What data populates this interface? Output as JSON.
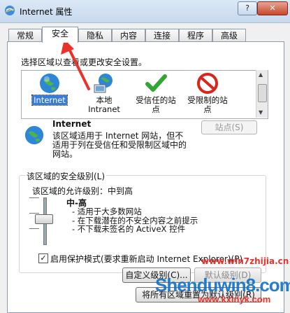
{
  "window": {
    "title": "Internet 属性",
    "help": "?",
    "close": "✕"
  },
  "tabs": [
    {
      "label": "常规"
    },
    {
      "label": "安全"
    },
    {
      "label": "隐私"
    },
    {
      "label": "内容"
    },
    {
      "label": "连接"
    },
    {
      "label": "程序"
    },
    {
      "label": "高级"
    }
  ],
  "zones": {
    "prompt": "选择区域以查看或更改安全设置。",
    "items": [
      {
        "label_1": "Internet",
        "label_2": "",
        "icon": "globe-icon"
      },
      {
        "label_1": "本地",
        "label_2": "Intranet",
        "icon": "intranet-icon"
      },
      {
        "label_1": "受信任的站",
        "label_2": "点",
        "icon": "checkmark-icon"
      },
      {
        "label_1": "受限制的站",
        "label_2": "点",
        "icon": "prohibited-icon"
      }
    ]
  },
  "zone_info": {
    "title": "Internet",
    "desc": "该区域适用于 Internet 网站，但不适用于列在受信任和受限制区域中的网站。",
    "sites_button": "站点(S)"
  },
  "security_level": {
    "group_label": "该区域的安全级别(L)",
    "allowed": "该区域的允许级别：中到高",
    "level_name": "中-高",
    "bullets": [
      "- 适用于大多数网站",
      "- 在下载潜在的不安全内容之前提示",
      "- 不下载未签名的 ActiveX 控件"
    ],
    "slider_level": "中-高"
  },
  "protected_mode": {
    "label": "启用保护模式(要求重新启动 Internet Explorer)(P)",
    "checked": true
  },
  "buttons": {
    "custom": "自定义级别(C)...",
    "default": "默认级别(D)",
    "reset": "将所有区域重置为默认级别(R)"
  },
  "watermark": {
    "line1": "www.win7zhijia.cn",
    "line2": "Shenduwin8.com",
    "line3": "www.kxinyk.com"
  },
  "colors": {
    "accent": "#3a7bd5",
    "arrow": "#e8322a",
    "warning": "#e8322a",
    "checkmark": "#33a532"
  }
}
